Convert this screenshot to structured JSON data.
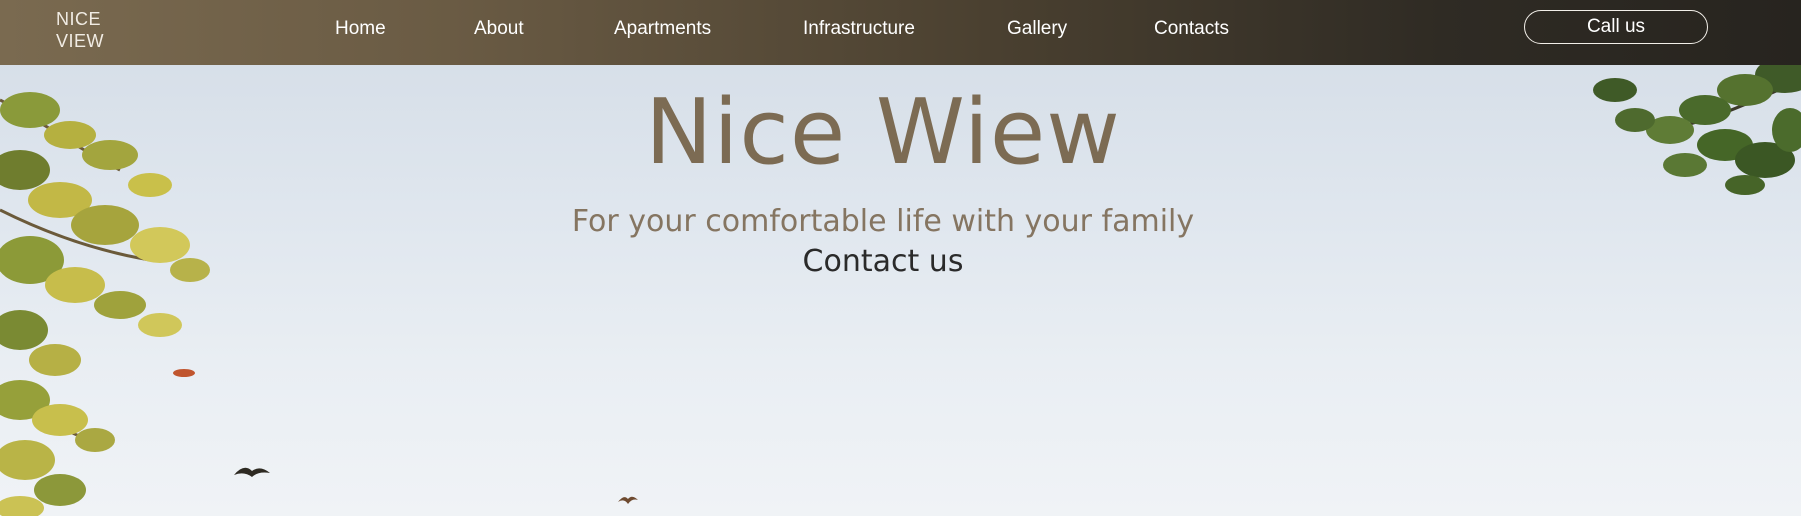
{
  "header": {
    "logo": "NICE\nVIEW",
    "logo_line1": "NICE",
    "logo_line2": "VIEW",
    "nav": [
      {
        "label": "Home"
      },
      {
        "label": "About"
      },
      {
        "label": "Apartments"
      },
      {
        "label": "Infrastructure"
      },
      {
        "label": "Gallery"
      },
      {
        "label": "Contacts"
      }
    ],
    "call_label": "Call us"
  },
  "hero": {
    "title": "Nice Wiew",
    "subtitle": "For your comfortable life with your family",
    "contact_label": "Contact us"
  },
  "colors": {
    "header_start": "#7a6a50",
    "header_end": "#27241f",
    "title": "#7c6b53",
    "sky": "#dfe6ee"
  }
}
